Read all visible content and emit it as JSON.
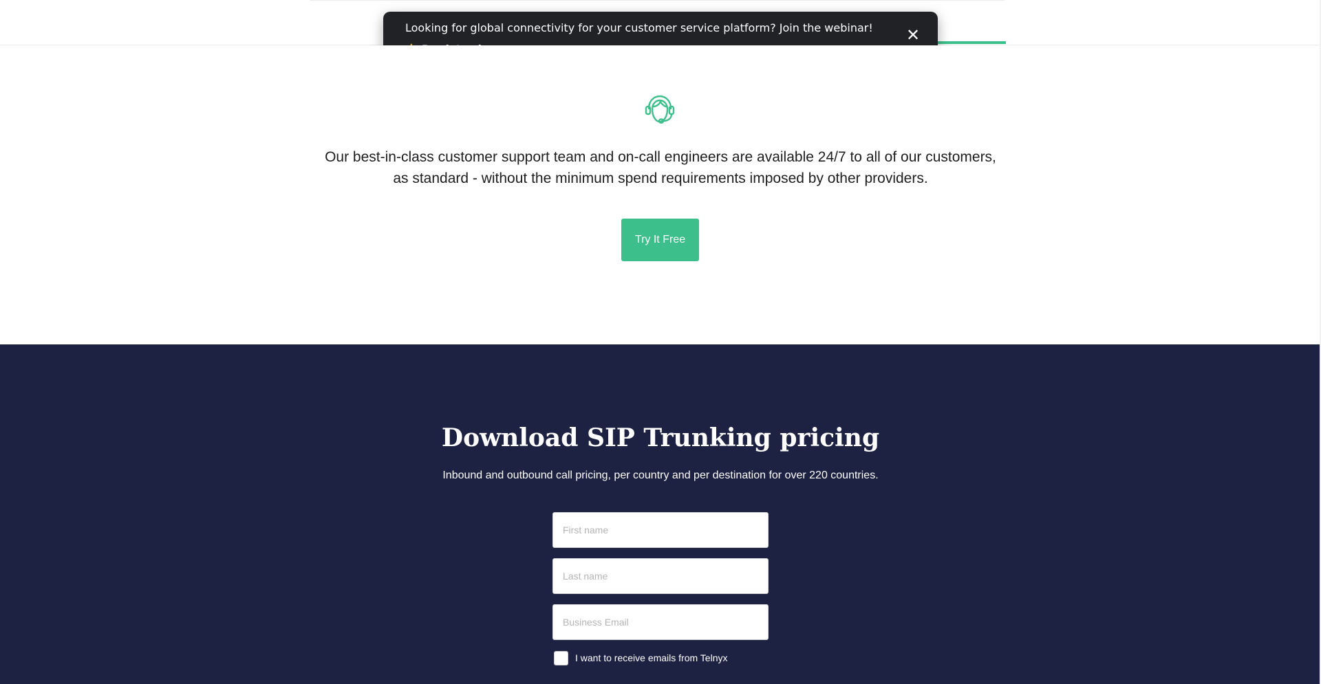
{
  "banner": {
    "message": "Looking for global connectivity for your customer service platform? Join the webinar!",
    "link_emoji": "👉",
    "link_label": "Register here",
    "close_glyph": "✕"
  },
  "support": {
    "icon": "headset-icon",
    "text": "Our best-in-class customer support team and on-call engineers are available 24/7 to all of our customers, as standard - without the minimum spend requirements imposed by other providers.",
    "cta_label": "Try It Free"
  },
  "pricing": {
    "title": "Download SIP Trunking pricing",
    "subtitle": "Inbound and outbound call pricing, per country and per destination for over 220 countries.",
    "form": {
      "first_name": {
        "value": "",
        "placeholder": "First name"
      },
      "last_name": {
        "value": "",
        "placeholder": "Last name"
      },
      "email": {
        "value": "",
        "placeholder": "Business Email"
      },
      "consent_label": "I want to receive emails from Telnyx",
      "consent_checked": false
    }
  },
  "colors": {
    "accent": "#3dbf8b",
    "banner_bg": "#212226",
    "pricing_bg": "#1d2242",
    "text_dark": "#1d1d1f"
  }
}
